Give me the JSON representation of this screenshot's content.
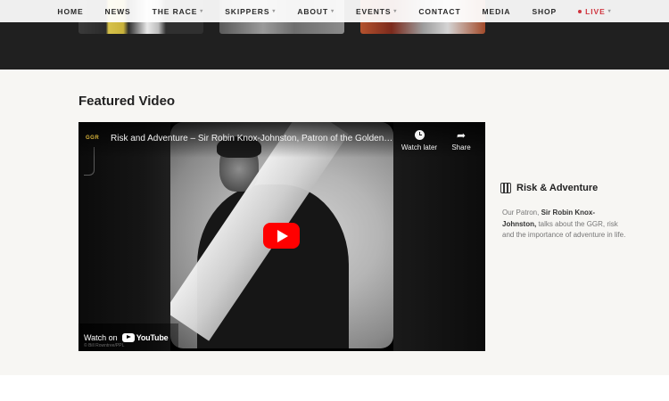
{
  "nav": {
    "items": [
      {
        "label": "HOME",
        "caret": false
      },
      {
        "label": "NEWS",
        "caret": false
      },
      {
        "label": "THE RACE",
        "caret": true
      },
      {
        "label": "SKIPPERS",
        "caret": true
      },
      {
        "label": "ABOUT",
        "caret": true
      },
      {
        "label": "EVENTS",
        "caret": true
      },
      {
        "label": "CONTACT",
        "caret": false
      },
      {
        "label": "MEDIA",
        "caret": false
      },
      {
        "label": "SHOP",
        "caret": false
      }
    ],
    "live_label": "LIVE"
  },
  "section": {
    "title": "Featured Video"
  },
  "video": {
    "channel_logo": "GGR",
    "title": "Risk and Adventure – Sir Robin Knox-Johnston, Patron of the Golden Globe Race",
    "watch_later": "Watch later",
    "share": "Share",
    "watch_on": "Watch on",
    "youtube": "YouTube",
    "copyright": "© Bill Rowntree/PPL"
  },
  "side": {
    "title": "Risk & Adventure",
    "desc_pre": "Our Patron, ",
    "desc_bold": "Sir Robin Knox-Johnston,",
    "desc_post": " talks about the GGR, risk and the importance of adventure in life."
  },
  "colors": {
    "accent_live": "#d0353f",
    "play_red": "#ff0000",
    "dark_band": "#202020"
  }
}
